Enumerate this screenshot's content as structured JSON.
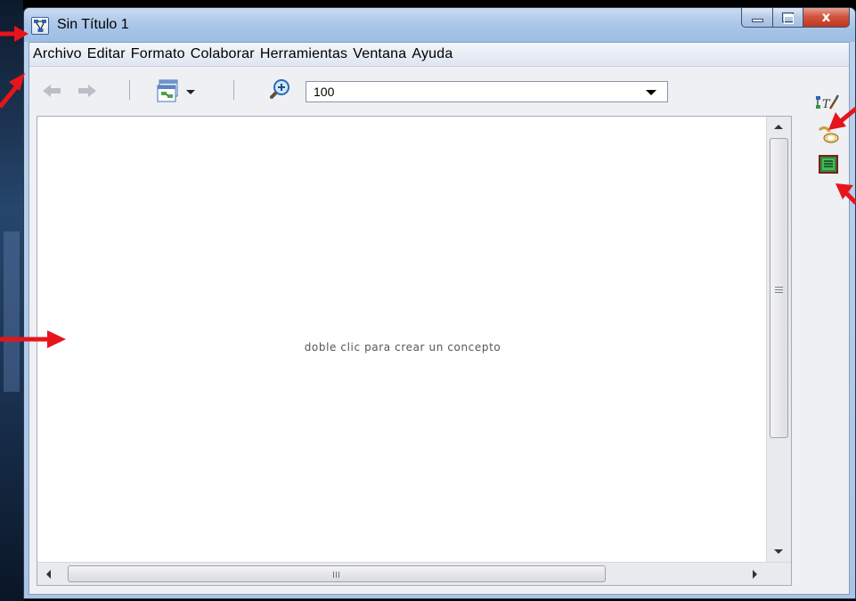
{
  "window": {
    "title": "Sin Título 1",
    "caption": {
      "close_glyph": "x"
    }
  },
  "menubar": {
    "items": [
      "Archivo",
      "Editar",
      "Formato",
      "Colaborar",
      "Herramientas",
      "Ventana",
      "Ayuda"
    ]
  },
  "toolbar": {
    "zoom_value": "100"
  },
  "canvas": {
    "hint": "doble clic para crear un concepto"
  },
  "colors": {
    "annotation_arrow": "#e8141b",
    "titlebar": "#aac6e8",
    "close_button": "#c9452d"
  },
  "icons": {
    "back": "arrow-left-icon",
    "forward": "arrow-right-icon",
    "view": "window-view-icon",
    "zoom": "zoom-in-icon",
    "styles": "styles-palette-icon",
    "format": "paint-brush-icon",
    "outline": "outline-list-icon"
  }
}
